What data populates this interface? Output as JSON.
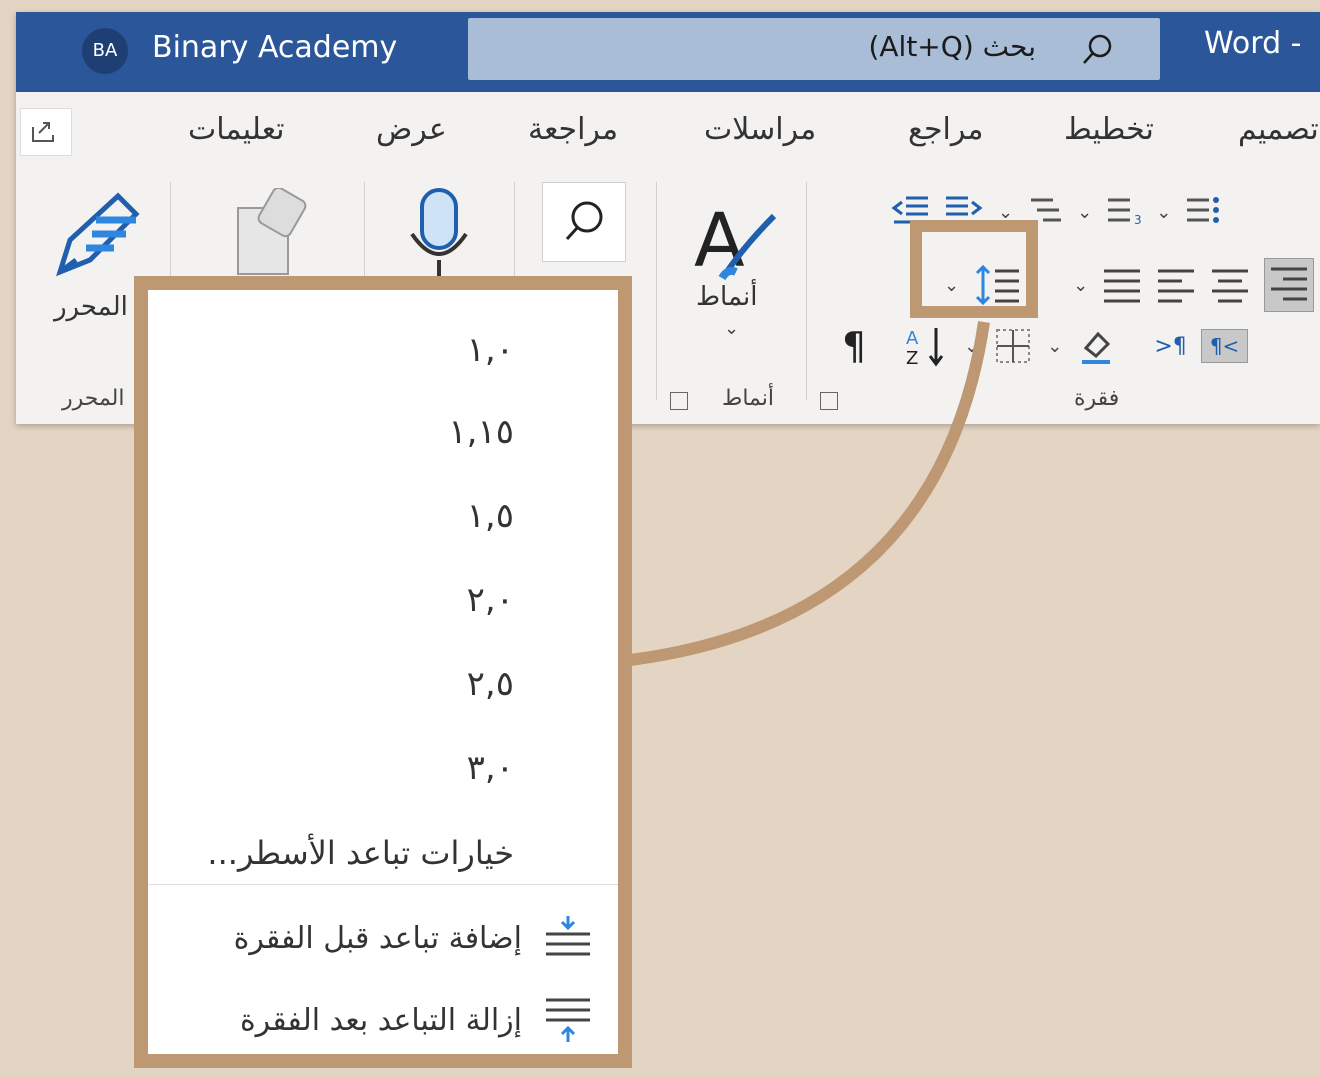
{
  "titlebar": {
    "user_initials": "BA",
    "user_name": "Binary Academy",
    "search_text": "بحث (Alt+Q)",
    "app_name": "Word -"
  },
  "tabs": [
    {
      "label": "تعليمات"
    },
    {
      "label": "عرض"
    },
    {
      "label": "مراجعة"
    },
    {
      "label": "مراسلات"
    },
    {
      "label": "مراجع"
    },
    {
      "label": "تخطيط"
    },
    {
      "label": "تصميم"
    }
  ],
  "ribbon": {
    "editor_button_label": "المحرر",
    "editor_group_label": "المحرر",
    "styles_button_label": "أنماط",
    "styles_group_label": "أنماط",
    "paragraph_group_label": "فقرة"
  },
  "line_spacing_menu": {
    "options": [
      "١,٠",
      "١,١٥",
      "١,٥",
      "٢,٠",
      "٢,٥",
      "٣,٠"
    ],
    "more_options_label": "خيارات تباعد الأسطر...",
    "add_space_before_label": "إضافة تباعد قبل الفقرة",
    "remove_space_after_label": "إزالة التباعد بعد الفقرة"
  },
  "colors": {
    "titlebar": "#2b579a",
    "highlight": "#bd9873",
    "background": "#e4d4c3",
    "accent_icon": "#2e86de"
  }
}
